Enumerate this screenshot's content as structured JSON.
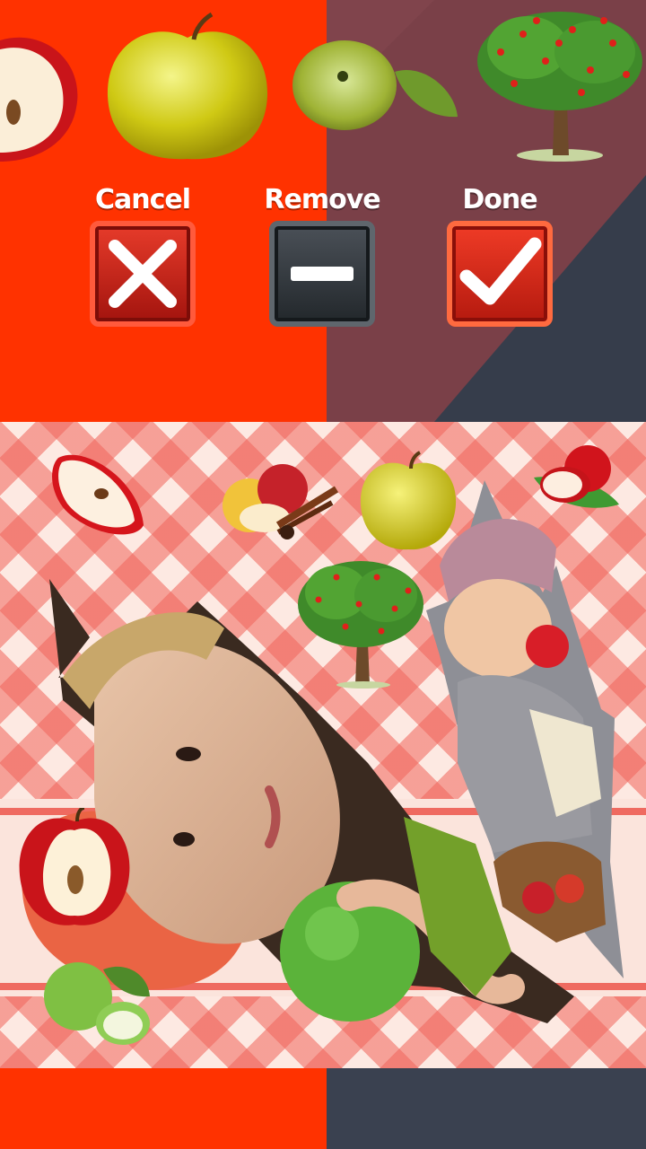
{
  "toolbar": {
    "cancel_label": "Cancel",
    "remove_label": "Remove",
    "done_label": "Done"
  },
  "stickers": {
    "items": [
      "apple-half-icon",
      "yellow-apple-icon",
      "green-apple-icon",
      "apple-tree-icon"
    ]
  },
  "canvas": {
    "items": [
      "apple-slice-icon",
      "apple-cinnamon-icon",
      "yellow-apple-icon",
      "apples-leaves-icon",
      "apple-tree-icon",
      "apple-half-icon",
      "green-apples-icon"
    ]
  },
  "colors": {
    "left_bg": "#ff3200",
    "right_bg": "#7a4048",
    "dark_bg": "#3a4150",
    "cancel_red": "#c3221a",
    "remove_dark": "#2f353a",
    "done_red": "#d6281b"
  }
}
